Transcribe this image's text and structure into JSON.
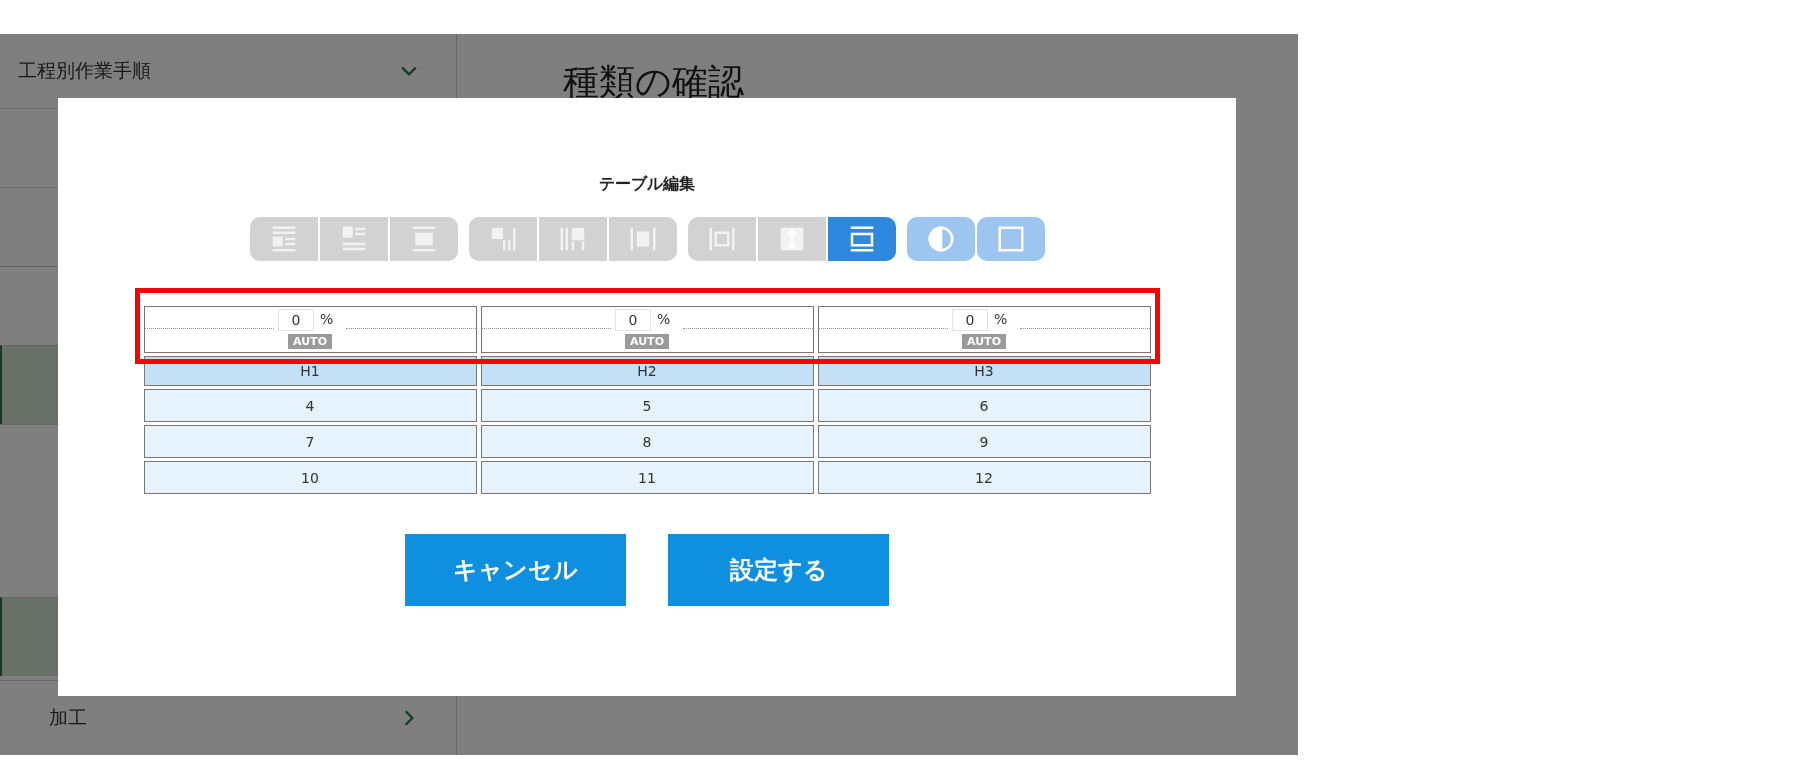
{
  "background": {
    "sidebar": {
      "items": [
        {
          "label": "工程別作業手順",
          "expanded": true
        },
        {
          "label": "加工",
          "expanded": false
        }
      ]
    },
    "page_title": "種類の確認"
  },
  "dialog": {
    "title": "テーブル編集",
    "toolbar": [
      [
        {
          "kind": "row-below",
          "selected": false,
          "disabled": true
        },
        {
          "kind": "row-above",
          "selected": false,
          "disabled": true
        },
        {
          "kind": "row-delete",
          "selected": false,
          "disabled": true
        }
      ],
      [
        {
          "kind": "col-left",
          "selected": false,
          "disabled": true
        },
        {
          "kind": "col-right",
          "selected": false,
          "disabled": true
        },
        {
          "kind": "col-delete",
          "selected": false,
          "disabled": true
        }
      ],
      [
        {
          "kind": "merge",
          "selected": false,
          "disabled": true
        },
        {
          "kind": "split",
          "selected": false,
          "disabled": true
        },
        {
          "kind": "width",
          "selected": true,
          "disabled": false
        }
      ],
      [
        {
          "kind": "contrast",
          "selected": false,
          "disabled": false
        },
        {
          "kind": "frame",
          "selected": false,
          "disabled": false
        }
      ]
    ],
    "column_widths": [
      {
        "value": "0",
        "unit": "%",
        "auto": "AUTO"
      },
      {
        "value": "0",
        "unit": "%",
        "auto": "AUTO"
      },
      {
        "value": "0",
        "unit": "%",
        "auto": "AUTO"
      }
    ],
    "rows": [
      {
        "kind": "header",
        "cells": [
          "H1",
          "H2",
          "H3"
        ]
      },
      {
        "kind": "body",
        "cells": [
          "4",
          "5",
          "6"
        ]
      },
      {
        "kind": "body",
        "cells": [
          "7",
          "8",
          "9"
        ]
      },
      {
        "kind": "body",
        "cells": [
          "10",
          "11",
          "12"
        ]
      }
    ],
    "buttons": [
      "キャンセル",
      "設定する"
    ]
  }
}
